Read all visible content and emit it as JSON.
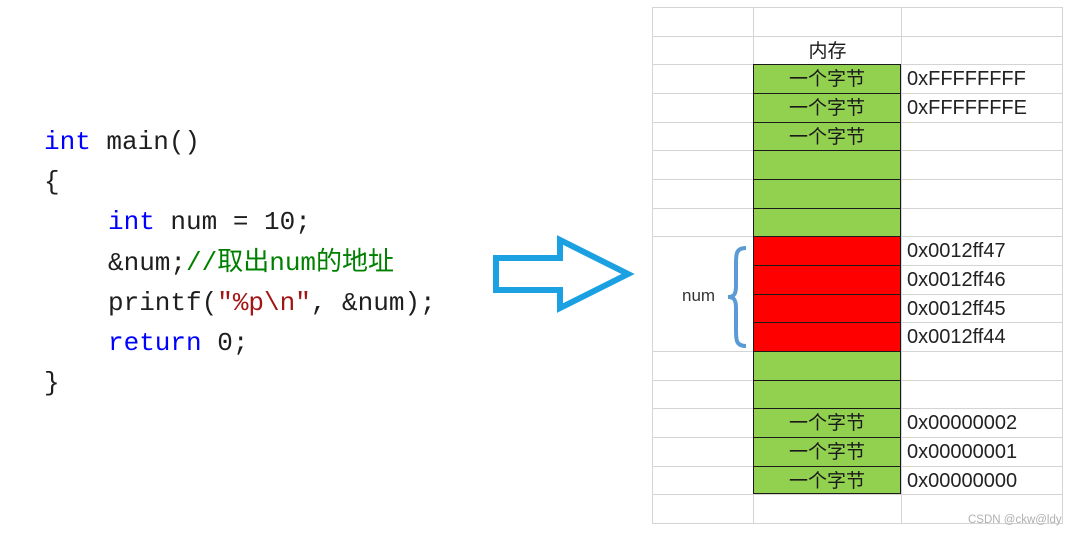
{
  "code": {
    "lines": [
      {
        "indent": false,
        "tokens": [
          {
            "t": "int",
            "c": "kw"
          },
          {
            "t": " main()",
            "c": ""
          }
        ]
      },
      {
        "indent": false,
        "tokens": [
          {
            "t": "{",
            "c": ""
          }
        ]
      },
      {
        "indent": true,
        "tokens": [
          {
            "t": "int",
            "c": "kw"
          },
          {
            "t": " num = 10;",
            "c": ""
          }
        ]
      },
      {
        "indent": true,
        "tokens": [
          {
            "t": "&num;",
            "c": ""
          },
          {
            "t": "//取出num的地址",
            "c": "cmt"
          }
        ]
      },
      {
        "indent": true,
        "tokens": [
          {
            "t": "printf(",
            "c": ""
          },
          {
            "t": "\"%p\\n\"",
            "c": "str"
          },
          {
            "t": ", &num);",
            "c": ""
          }
        ]
      },
      {
        "indent": true,
        "tokens": [
          {
            "t": "return",
            "c": "kw"
          },
          {
            "t": " 0;",
            "c": ""
          }
        ]
      },
      {
        "indent": false,
        "tokens": [
          {
            "t": "}",
            "c": ""
          }
        ]
      }
    ]
  },
  "arrow": {
    "icon": "right-arrow-outline-icon",
    "color": "#1ba1e2"
  },
  "memory": {
    "header": "内存",
    "colors": {
      "byte": "#92d050",
      "num_byte": "#ff0000",
      "brace": "#5b9bd5"
    },
    "rows": [
      {
        "fill": null,
        "label": "",
        "address": ""
      },
      {
        "fill": null,
        "label": "内存",
        "address": "",
        "header": true
      },
      {
        "fill": "green",
        "label": "一个字节",
        "address": "0xFFFFFFFF"
      },
      {
        "fill": "green",
        "label": "一个字节",
        "address": "0xFFFFFFFE"
      },
      {
        "fill": "green",
        "label": "一个字节",
        "address": ""
      },
      {
        "fill": "green",
        "label": "",
        "address": ""
      },
      {
        "fill": "green",
        "label": "",
        "address": ""
      },
      {
        "fill": "green",
        "label": "",
        "address": ""
      },
      {
        "fill": "red",
        "label": "",
        "address": "0x0012ff47"
      },
      {
        "fill": "red",
        "label": "",
        "address": "0x0012ff46"
      },
      {
        "fill": "red",
        "label": "",
        "address": "0x0012ff45"
      },
      {
        "fill": "red",
        "label": "",
        "address": "0x0012ff44"
      },
      {
        "fill": "green",
        "label": "",
        "address": ""
      },
      {
        "fill": "green",
        "label": "",
        "address": ""
      },
      {
        "fill": "green",
        "label": "一个字节",
        "address": "0x00000002"
      },
      {
        "fill": "green",
        "label": "一个字节",
        "address": "0x00000001"
      },
      {
        "fill": "green",
        "label": "一个字节",
        "address": "0x00000000"
      },
      {
        "fill": null,
        "label": "",
        "address": ""
      }
    ],
    "variable_label": "num"
  },
  "watermark": "CSDN @ckw@ldy"
}
